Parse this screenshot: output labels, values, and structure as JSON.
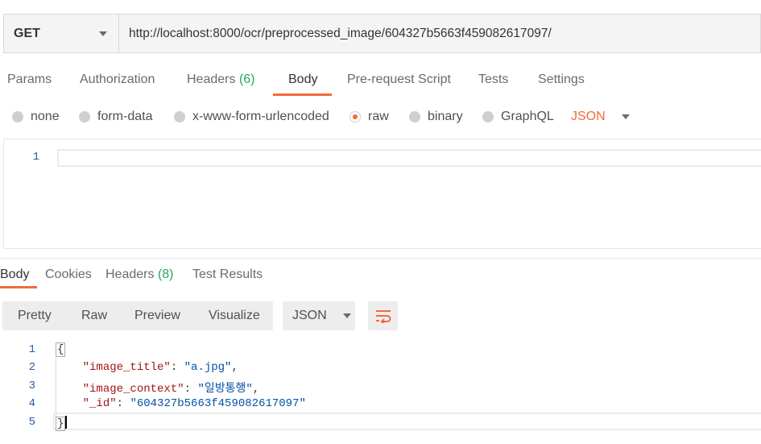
{
  "request": {
    "method": "GET",
    "url": "http://localhost:8000/ocr/preprocessed_image/604327b5663f459082617097/"
  },
  "request_tabs": [
    {
      "label": "Params"
    },
    {
      "label": "Authorization"
    },
    {
      "label": "Headers",
      "count": "(6)"
    },
    {
      "label": "Body",
      "active": true
    },
    {
      "label": "Pre-request Script"
    },
    {
      "label": "Tests"
    },
    {
      "label": "Settings"
    }
  ],
  "body_types": {
    "options": [
      "none",
      "form-data",
      "x-www-form-urlencoded",
      "raw",
      "binary",
      "GraphQL"
    ],
    "selected": "raw",
    "format": "JSON"
  },
  "request_editor": {
    "line_numbers": [
      "1"
    ]
  },
  "response_tabs": [
    {
      "label": "Body",
      "active": true
    },
    {
      "label": "Cookies"
    },
    {
      "label": "Headers",
      "count": "(8)"
    },
    {
      "label": "Test Results"
    }
  ],
  "response_toolbar": {
    "views": [
      "Pretty",
      "Raw",
      "Preview",
      "Visualize"
    ],
    "format": "JSON",
    "wrap_icon": "wrap-lines-icon"
  },
  "response_body": {
    "line_numbers": [
      "1",
      "2",
      "3",
      "4",
      "5"
    ],
    "open_brace": "{",
    "close_brace": "}",
    "fields": [
      {
        "key": "\"image_title\"",
        "value": "\"a.jpg\"",
        "comma": ","
      },
      {
        "key": "\"image_context\"",
        "value": "\"일방통행\"",
        "comma": ","
      },
      {
        "key": "\"_id\"",
        "value": "\"604327b5663f459082617097\"",
        "comma": ""
      }
    ]
  },
  "colors": {
    "accent": "#f26b3a",
    "count_green": "#26a65b",
    "json_key": "#a31515",
    "json_string": "#0451a5",
    "line_number": "#2a5f9e"
  }
}
